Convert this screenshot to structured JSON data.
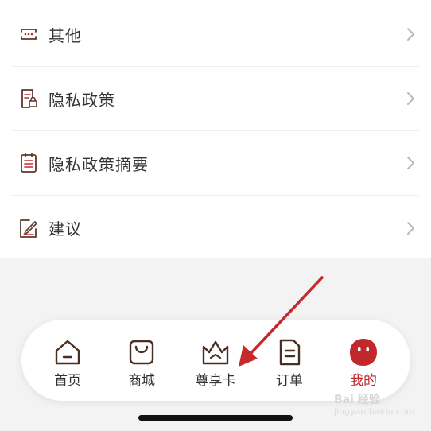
{
  "menu": {
    "items": [
      {
        "label": "其他",
        "icon": "more-dots-icon"
      },
      {
        "label": "隐私政策",
        "icon": "privacy-lock-document-icon"
      },
      {
        "label": "隐私政策摘要",
        "icon": "document-list-icon"
      },
      {
        "label": "建议",
        "icon": "edit-feedback-icon"
      }
    ]
  },
  "tabbar": {
    "tabs": [
      {
        "label": "首页",
        "icon": "home-icon"
      },
      {
        "label": "商城",
        "icon": "shopping-bag-icon"
      },
      {
        "label": "尊享卡",
        "icon": "crown-icon"
      },
      {
        "label": "订单",
        "icon": "order-document-icon"
      },
      {
        "label": "我的",
        "icon": "profile-face-icon"
      }
    ],
    "active_index": 4
  },
  "watermark": {
    "text": "Bai 经验",
    "sub": "jingyan.baidu.com"
  },
  "colors": {
    "accent": "#c0282e",
    "annotation_arrow": "#c42a2a",
    "icon_brown": "#5a3a2a"
  }
}
